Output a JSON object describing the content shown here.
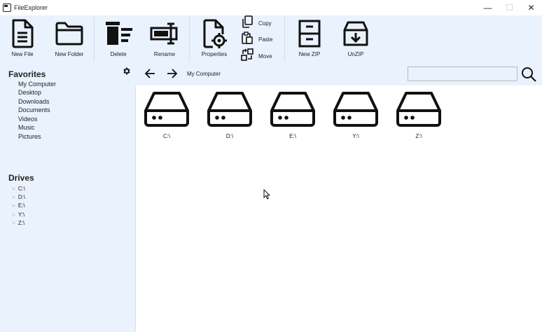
{
  "window": {
    "title": "FileExplorer",
    "minimize_glyph": "—",
    "maximize_glyph": "☐",
    "close_glyph": "✕"
  },
  "ribbon": {
    "new_file": "New File",
    "new_folder": "New Folder",
    "delete": "Delete",
    "rename": "Rename",
    "properties": "Properties",
    "copy": "Copy",
    "paste": "Paste",
    "move": "Move",
    "new_zip": "New ZIP",
    "unzip": "UnZIP"
  },
  "sidebar": {
    "favorites_title": "Favorites",
    "favorites": [
      "My Computer",
      "Desktop",
      "Downloads",
      "Documents",
      "Videos",
      "Music",
      "Pictures"
    ],
    "drives_title": "Drives",
    "drives": [
      "C:\\",
      "D:\\",
      "E:\\",
      "Y:\\",
      "Z:\\"
    ]
  },
  "nav": {
    "path": "My Computer",
    "search_value": ""
  },
  "content": {
    "drives": [
      "C:\\",
      "D:\\",
      "E:\\",
      "Y:\\",
      "Z:\\"
    ]
  },
  "icons": {
    "app": "app-icon",
    "new_file": "document-icon",
    "new_folder": "folder-icon",
    "delete": "trash-icon",
    "rename": "rename-icon",
    "properties": "document-gear-icon",
    "copy": "copy-icon",
    "paste": "paste-icon",
    "move": "move-icon",
    "new_zip": "archive-icon",
    "unzip": "archive-download-icon",
    "settings": "gear-icon",
    "back": "arrow-left-icon",
    "forward": "arrow-right-icon",
    "search": "search-icon",
    "drive": "hard-drive-icon"
  },
  "colors": {
    "panel_bg": "#eaf2fd",
    "content_bg": "#ffffff",
    "icon_stroke": "#111111"
  }
}
